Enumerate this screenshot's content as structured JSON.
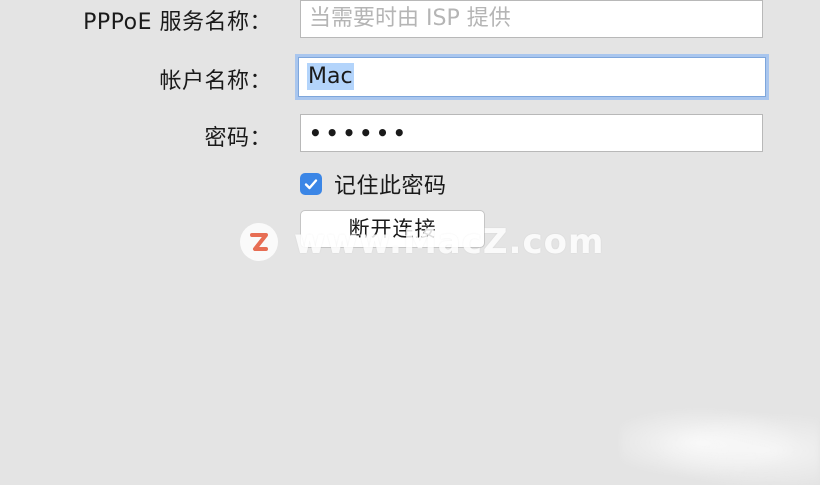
{
  "form": {
    "pppoe_service": {
      "label": "PPPoE 服务名称：",
      "placeholder": "当需要时由 ISP 提供",
      "value": ""
    },
    "account_name": {
      "label": "帐户名称：",
      "value": "Mac"
    },
    "password": {
      "label": "密码：",
      "value": "••••••"
    },
    "remember_password": {
      "label": "记住此密码",
      "checked": true
    },
    "disconnect_button": {
      "label": "断开连接"
    }
  },
  "watermark": {
    "logo_letter": "Z",
    "text": "www.MacZ.com"
  },
  "colors": {
    "background": "#e4e4e4",
    "checkbox_accent": "#3b86e6",
    "focus_ring": "#a9c6ee",
    "selection": "#b3d4fb",
    "watermark_logo": "#e85a3c"
  }
}
